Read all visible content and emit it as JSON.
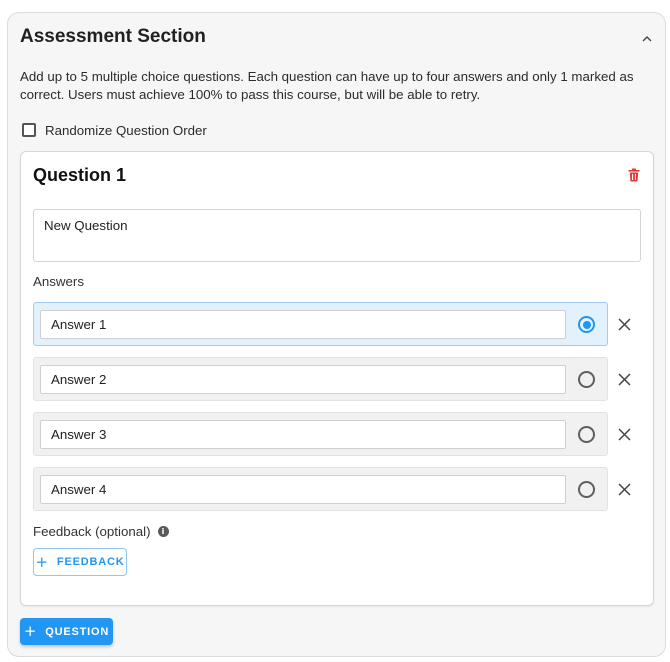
{
  "section": {
    "title": "Assessment Section",
    "description": "Add up to 5 multiple choice questions. Each question can have up to four answers and only 1 marked as correct. Users must achieve 100% to pass this course, but will be able to retry.",
    "randomize_label": "Randomize Question Order",
    "randomize_checked": false
  },
  "question": {
    "title": "Question 1",
    "text": "New Question",
    "answers_label": "Answers",
    "answers": [
      {
        "value": "Answer 1",
        "correct": true
      },
      {
        "value": "Answer 2",
        "correct": false
      },
      {
        "value": "Answer 3",
        "correct": false
      },
      {
        "value": "Answer 4",
        "correct": false
      }
    ],
    "feedback_label": "Feedback (optional)",
    "feedback_button": "FEEDBACK"
  },
  "add_question_button": "QUESTION",
  "colors": {
    "accent": "#2196f3",
    "delete": "#e53935",
    "selected_row": "#e3f1fd"
  }
}
